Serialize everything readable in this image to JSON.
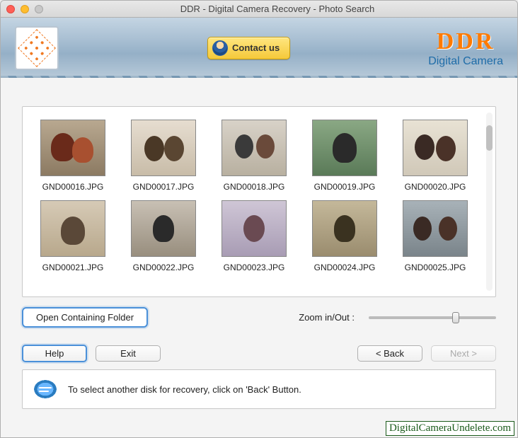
{
  "window": {
    "title": "DDR - Digital Camera Recovery - Photo Search"
  },
  "banner": {
    "contact_label": "Contact us",
    "brand_title": "DDR",
    "brand_subtitle": "Digital Camera"
  },
  "gallery": {
    "items": [
      {
        "filename": "GND00016.JPG"
      },
      {
        "filename": "GND00017.JPG"
      },
      {
        "filename": "GND00018.JPG"
      },
      {
        "filename": "GND00019.JPG"
      },
      {
        "filename": "GND00020.JPG"
      },
      {
        "filename": "GND00021.JPG"
      },
      {
        "filename": "GND00022.JPG"
      },
      {
        "filename": "GND00023.JPG"
      },
      {
        "filename": "GND00024.JPG"
      },
      {
        "filename": "GND00025.JPG"
      }
    ]
  },
  "controls": {
    "open_folder_label": "Open Containing Folder",
    "zoom_label": "Zoom in/Out :"
  },
  "nav": {
    "help_label": "Help",
    "exit_label": "Exit",
    "back_label": "< Back",
    "next_label": "Next >"
  },
  "hint": {
    "text": "To select another disk for recovery, click on 'Back' Button."
  },
  "watermark": "DigitalCameraUndelete.com"
}
